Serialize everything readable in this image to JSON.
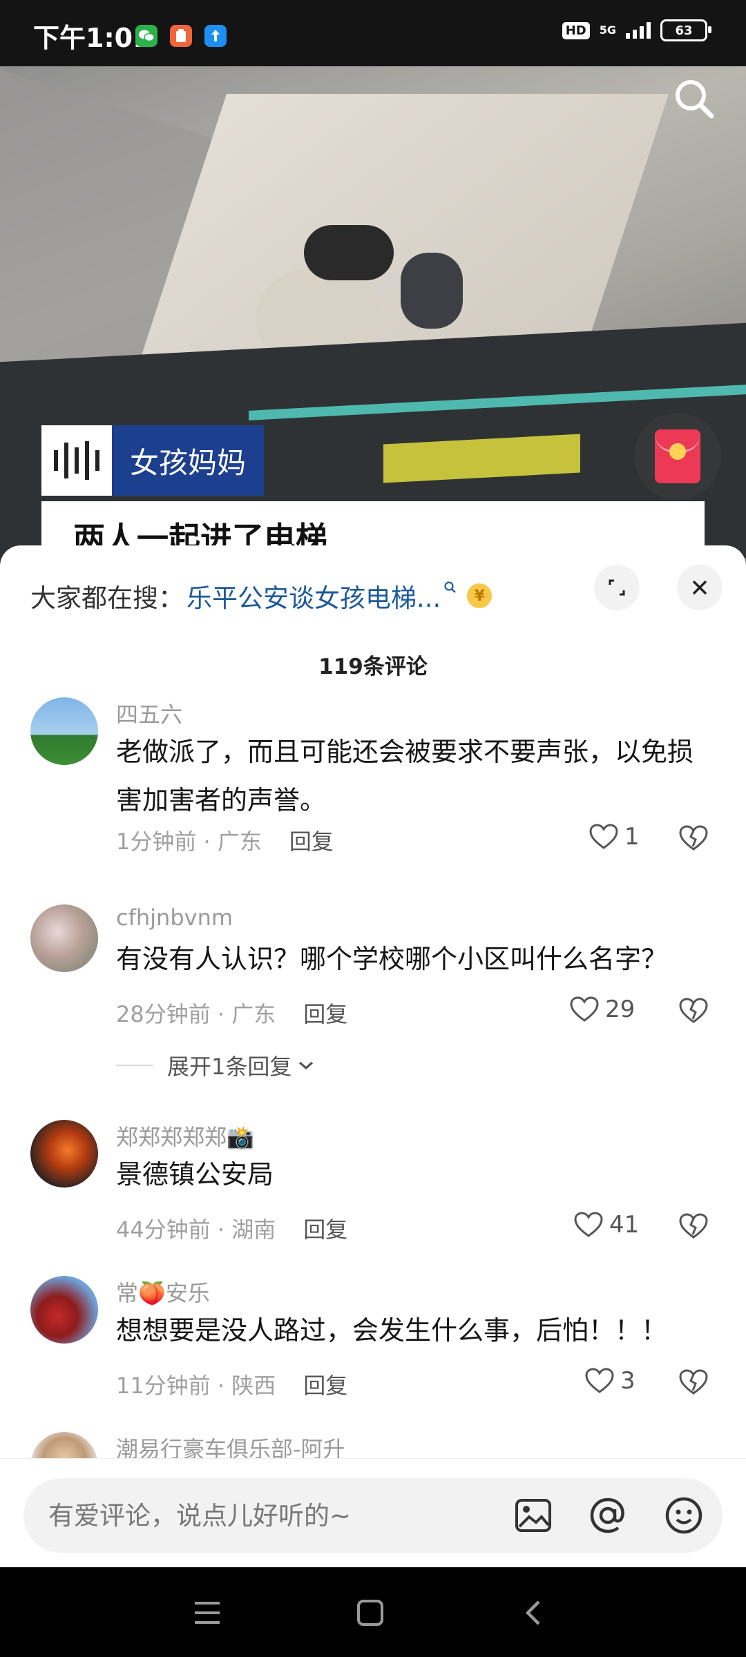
{
  "status_bar": {
    "time": "下午1:01",
    "hd_label": "HD",
    "network": "5G",
    "battery": "63",
    "app_icons": [
      {
        "name": "wechat-icon",
        "color": "#2bb24c"
      },
      {
        "name": "orange-app-icon",
        "color": "#f0653b"
      },
      {
        "name": "blue-upload-icon",
        "color": "#1c8ff0"
      }
    ]
  },
  "video": {
    "speaker_name": "女孩妈妈",
    "subtitle": "两人一起进了电梯"
  },
  "comments_panel": {
    "trending_label": "大家都在搜：",
    "trending_query": "乐平公安谈女孩电梯...",
    "coin_symbol": "¥",
    "comment_count": "119条评论",
    "comments": [
      {
        "username": "四五六",
        "text": "老做派了，而且可能还会被要求不要声张，以免损害加害者的声誉。",
        "time": "1分钟前",
        "location": "广东",
        "reply_label": "回复",
        "likes": "1"
      },
      {
        "username": "cfhjnbvnm",
        "text": "有没有人认识？哪个学校哪个小区叫什么名字？",
        "time": "28分钟前",
        "location": "广东",
        "reply_label": "回复",
        "likes": "29",
        "expand_label": "展开1条回复"
      },
      {
        "username": "郑郑郑郑郑📸",
        "text": "景德镇公安局",
        "time": "44分钟前",
        "location": "湖南",
        "reply_label": "回复",
        "likes": "41"
      },
      {
        "username": "常🍑安乐",
        "text": "想想要是没人路过，会发生什么事，后怕！！！",
        "time": "11分钟前",
        "location": "陕西",
        "reply_label": "回复",
        "likes": "3"
      },
      {
        "username": "潮易行豪车俱乐部-阿升"
      }
    ],
    "meta_separator": " · "
  },
  "input": {
    "placeholder": "有爱评论，说点儿好听的~"
  },
  "colors": {
    "accent_link": "#1e5a9c",
    "speaker_tag_bg": "#1d3f8f",
    "red_packet": "#ec3a56"
  }
}
